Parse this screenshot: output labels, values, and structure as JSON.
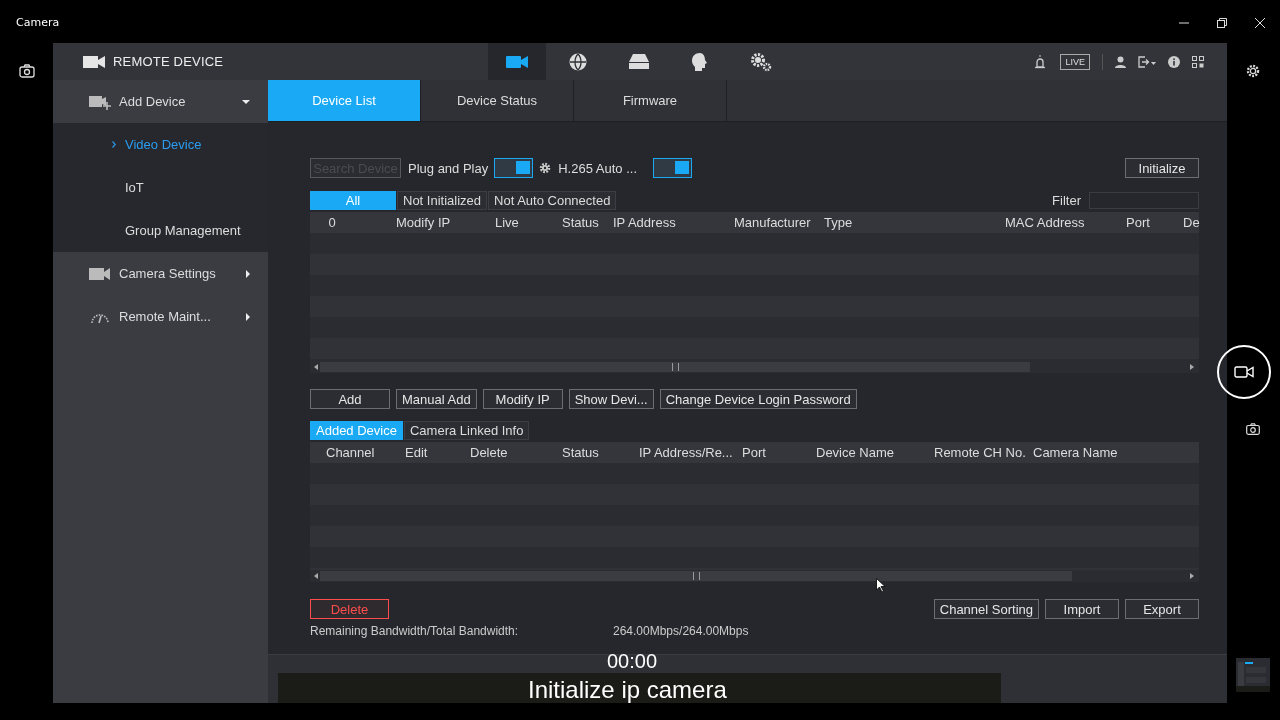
{
  "window": {
    "title": "Camera"
  },
  "header": {
    "title": "REMOTE DEVICE",
    "nav": [
      {
        "kind": "camera",
        "selected": true
      },
      {
        "kind": "globe",
        "selected": false
      },
      {
        "kind": "storage",
        "selected": false
      },
      {
        "kind": "head",
        "selected": false
      },
      {
        "kind": "gears",
        "selected": false
      }
    ],
    "live_badge": "LIVE"
  },
  "sidebar": {
    "items": [
      {
        "label": "Add Device",
        "kind": "add-device",
        "expanded": true,
        "children": [
          {
            "label": "Video Device",
            "selected": true
          },
          {
            "label": "IoT",
            "selected": false
          },
          {
            "label": "Group Management",
            "selected": false
          }
        ]
      },
      {
        "label": "Camera Settings",
        "kind": "camera",
        "expanded": false
      },
      {
        "label": "Remote Maint...",
        "kind": "gauge",
        "expanded": false
      }
    ]
  },
  "tabs": [
    {
      "label": "Device List",
      "selected": true
    },
    {
      "label": "Device Status",
      "selected": false
    },
    {
      "label": "Firmware",
      "selected": false
    }
  ],
  "toolbar": {
    "search_button": {
      "label": "Search Device",
      "disabled": true
    },
    "plug_and_play": {
      "label": "Plug and Play",
      "on": true
    },
    "h265": {
      "label": "H.265 Auto ...",
      "on": true
    },
    "initialize_button": "Initialize"
  },
  "filter_tabs": [
    {
      "label": "All",
      "selected": true
    },
    {
      "label": "Not Initialized",
      "selected": false
    },
    {
      "label": "Not Auto Connected",
      "selected": false
    }
  ],
  "filter": {
    "label": "Filter"
  },
  "device_table": {
    "columns": [
      "0",
      "Modify IP",
      "Live",
      "Status",
      "IP Address",
      "Manufacturer",
      "Type",
      "MAC Address",
      "Port",
      "De"
    ]
  },
  "action_buttons": [
    "Add",
    "Manual Add",
    "Modify IP",
    "Show Devi...",
    "Change Device Login Password"
  ],
  "added_tabs": [
    {
      "label": "Added Device",
      "selected": true
    },
    {
      "label": "Camera Linked Info",
      "selected": false
    }
  ],
  "added_table": {
    "columns": [
      "Channel",
      "Edit",
      "Delete",
      "Status",
      "IP Address/Re...",
      "Port",
      "Device Name",
      "Remote CH No.",
      "Camera Name"
    ]
  },
  "bottom_buttons": [
    {
      "label": "Delete",
      "kind": "danger"
    },
    {
      "label": "Channel Sorting",
      "kind": "normal"
    },
    {
      "label": "Import",
      "kind": "normal"
    },
    {
      "label": "Export",
      "kind": "normal"
    }
  ],
  "bandwidth": {
    "label": "Remaining Bandwidth/Total Bandwidth:",
    "value": "264.00Mbps/264.00Mbps"
  },
  "timer": "00:00",
  "caption": "Initialize ip camera"
}
